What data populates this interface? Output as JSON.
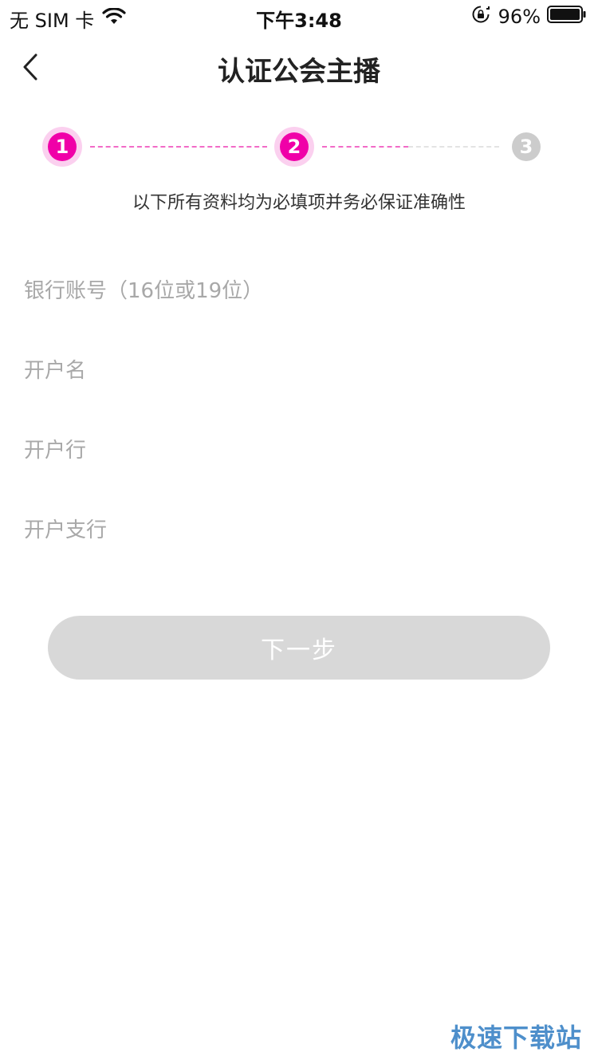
{
  "status_bar": {
    "carrier": "无 SIM 卡",
    "time": "下午3:48",
    "battery": "96%",
    "icons": [
      "wifi-icon",
      "rotation-lock-icon",
      "battery-icon"
    ]
  },
  "nav": {
    "title": "认证公会主播",
    "back_icon": "chevron-left-icon"
  },
  "stepper": {
    "steps": [
      {
        "label": "1",
        "state": "done"
      },
      {
        "label": "2",
        "state": "current"
      },
      {
        "label": "3",
        "state": "pending"
      }
    ],
    "active_color": "#f000a8",
    "inactive_color": "#cccccc"
  },
  "notice": "以下所有资料均为必填项并务必保证准确性",
  "form": {
    "fields": [
      {
        "placeholder": "银行账号（16位或19位）",
        "value": ""
      },
      {
        "placeholder": "开户名",
        "value": ""
      },
      {
        "placeholder": "开户行",
        "value": ""
      },
      {
        "placeholder": "开户支行",
        "value": ""
      }
    ]
  },
  "next_button": {
    "label": "下一步",
    "enabled": false,
    "color": "#d8d8d8"
  },
  "watermark": "极速下载站"
}
